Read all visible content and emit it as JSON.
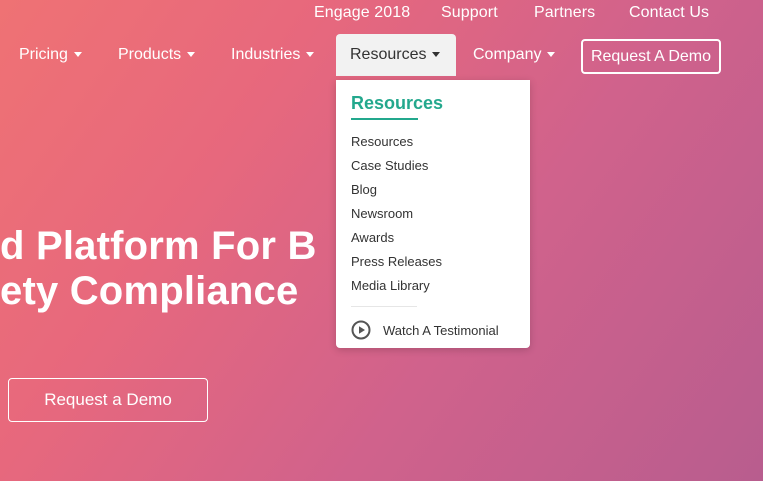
{
  "top_links": [
    "Engage 2018",
    "Support",
    "Partners",
    "Contact Us"
  ],
  "nav": {
    "items": [
      {
        "label": "Pricing"
      },
      {
        "label": "Products"
      },
      {
        "label": "Industries"
      },
      {
        "label": "Resources",
        "active": true
      },
      {
        "label": "Company"
      }
    ],
    "demo_button": "Request A Demo"
  },
  "dropdown": {
    "title": "Resources",
    "items": [
      "Resources",
      "Case Studies",
      "Blog",
      "Newsroom",
      "Awards",
      "Press Releases",
      "Media Library"
    ],
    "testimonial": {
      "label": "Watch A Testimonial",
      "icon": "play-circle-icon"
    }
  },
  "hero": {
    "line1": "d Platform For B",
    "line2": "ety Compliance",
    "cta": "Request a Demo"
  },
  "colors": {
    "accent": "#23a88d",
    "bg_start": "#ef7274",
    "bg_end": "#b85d8e",
    "active_tab_bg": "#f2f2f2"
  }
}
